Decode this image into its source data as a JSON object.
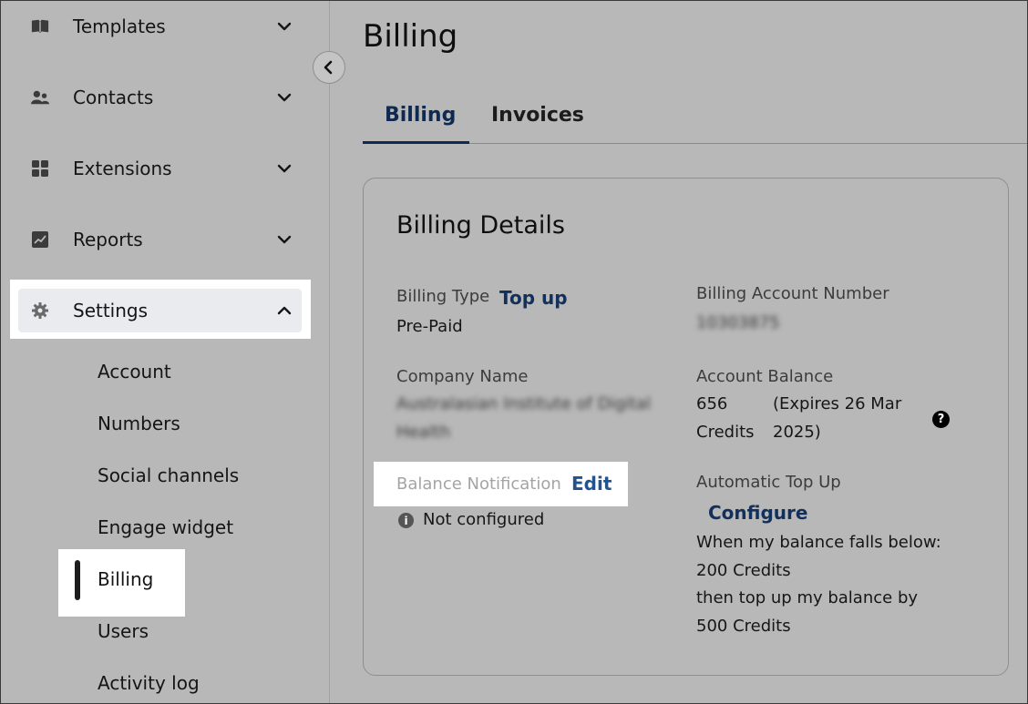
{
  "sidebar": {
    "items": [
      {
        "label": "Templates",
        "icon": "book-icon"
      },
      {
        "label": "Contacts",
        "icon": "contacts-icon"
      },
      {
        "label": "Extensions",
        "icon": "grid-icon"
      },
      {
        "label": "Reports",
        "icon": "chart-icon"
      },
      {
        "label": "Settings",
        "icon": "gear-icon"
      }
    ],
    "settings_subitems": [
      "Account",
      "Numbers",
      "Social channels",
      "Engage widget",
      "Billing",
      "Users",
      "Activity log"
    ]
  },
  "page": {
    "title": "Billing"
  },
  "tabs": [
    {
      "label": "Billing",
      "active": true
    },
    {
      "label": "Invoices",
      "active": false
    }
  ],
  "card": {
    "title": "Billing Details",
    "billing_type_label": "Billing Type",
    "billing_type_link": "Top up",
    "billing_type_value": "Pre-Paid",
    "account_number_label": "Billing Account Number",
    "account_number_value": "10303875",
    "company_name_label": "Company Name",
    "company_name_line1": "Australasian Institute of Digital",
    "company_name_line2": "Health",
    "account_balance_label": "Account Balance",
    "balance_amount": "656",
    "balance_unit": "Credits",
    "balance_expiry_line1": "(Expires 26 Mar",
    "balance_expiry_line2": "2025)",
    "balance_notification_label": "Balance Notification",
    "balance_notification_edit": "Edit",
    "balance_notification_status": "Not configured",
    "auto_topup_label": "Automatic Top Up",
    "auto_topup_link": "Configure",
    "auto_topup_line1": "When my balance falls below:",
    "auto_topup_line2": "200 Credits",
    "auto_topup_line3": "then top up my balance by",
    "auto_topup_line4": "500 Credits"
  },
  "colors": {
    "accent": "#13305d",
    "edit_link": "#23538c",
    "background": "#b8b8b8"
  }
}
